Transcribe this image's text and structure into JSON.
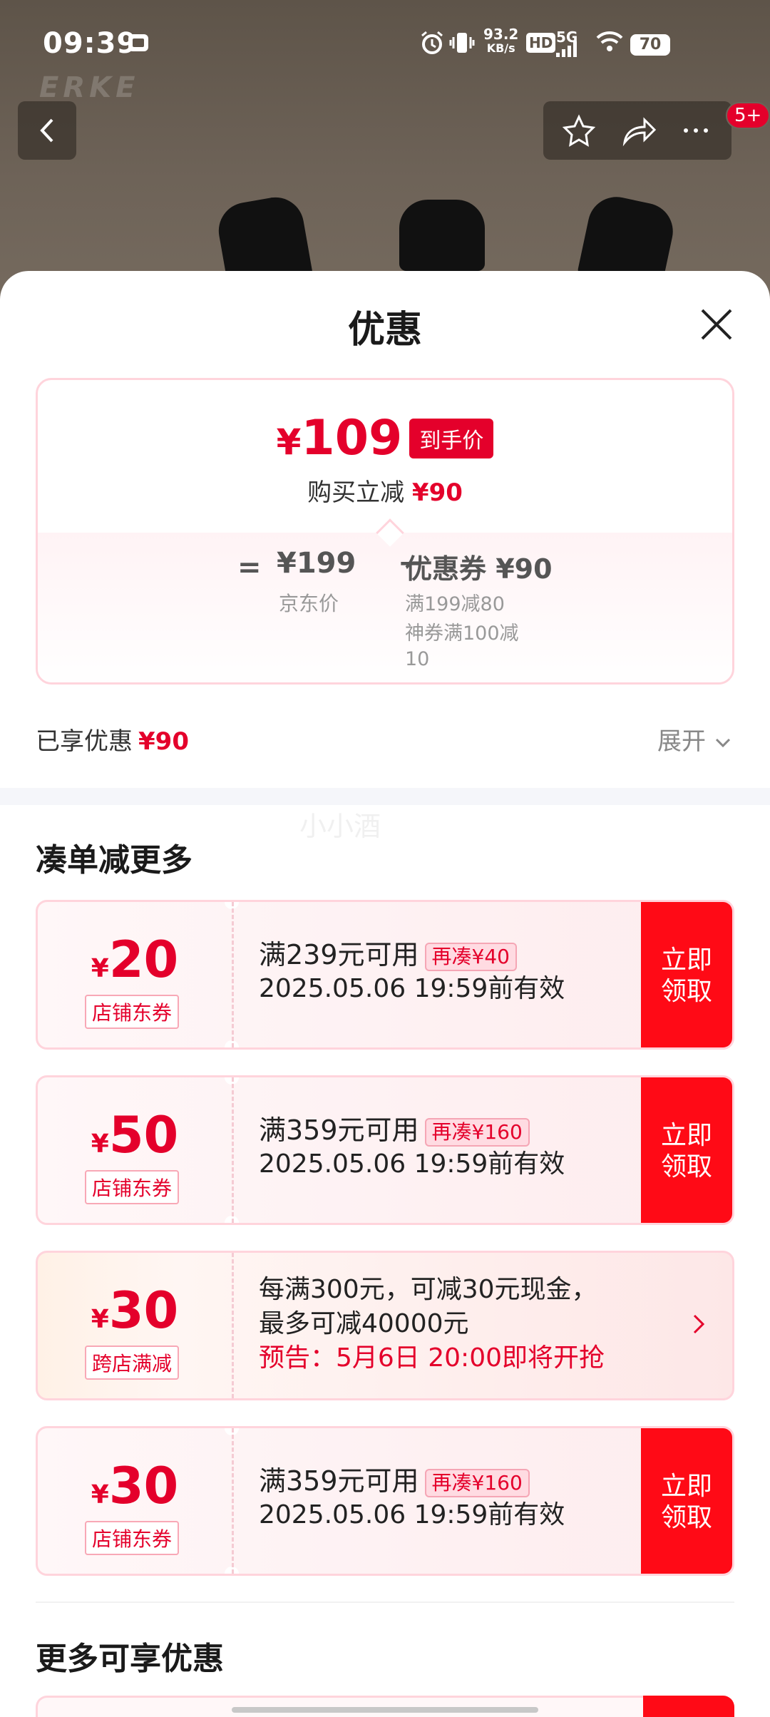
{
  "status_bar": {
    "time": "09:39",
    "speed": "93.2",
    "speed_unit": "KB/s",
    "hd": "HD",
    "network": "5G",
    "battery": "70"
  },
  "top_nav": {
    "logo_text": "ERKE",
    "notification_badge": "5+"
  },
  "sheet": {
    "title": "优惠",
    "final_price_symbol": "¥",
    "final_price": "109",
    "final_price_tag": "到手价",
    "instant_discount_label": "购买立减",
    "instant_discount_value": "¥90",
    "equals": "=",
    "jd_price": "¥199",
    "jd_price_label": "京东价",
    "minus": "−",
    "coupon_total": "优惠券 ¥90",
    "coupon_detail_1": "满199减80",
    "coupon_detail_2": "神券满100减10",
    "enjoyed_label": "已享优惠",
    "enjoyed_value": "¥90",
    "expand_label": "展开",
    "watermark": "小小酒"
  },
  "section_more_discounts": {
    "title": "凑单减更多",
    "coupons": [
      {
        "symbol": "¥",
        "amount": "20",
        "type": "店铺东券",
        "condition": "满239元可用",
        "pill": "再凑¥40",
        "validity": "2025.05.06 19:59前有效",
        "action": "立即领取"
      },
      {
        "symbol": "¥",
        "amount": "50",
        "type": "店铺东券",
        "condition": "满359元可用",
        "pill": "再凑¥160",
        "validity": "2025.05.06 19:59前有效",
        "action": "立即领取"
      },
      {
        "symbol": "¥",
        "amount": "30",
        "type": "跨店满减",
        "line1": "每满300元，可减30元现金，",
        "line2": "最多可减40000元",
        "line3": "预告：5月6日 20:00即将开抢"
      },
      {
        "symbol": "¥",
        "amount": "30",
        "type": "店铺东券",
        "condition": "满359元可用",
        "pill": "再凑¥160",
        "validity": "2025.05.06 19:59前有效",
        "action": "立即领取"
      }
    ]
  },
  "section_more_available": {
    "title": "更多可享优惠"
  },
  "colors": {
    "accent_red": "#e4002b",
    "button_red": "#ff0a16",
    "border_pink": "#ffd4dc"
  }
}
